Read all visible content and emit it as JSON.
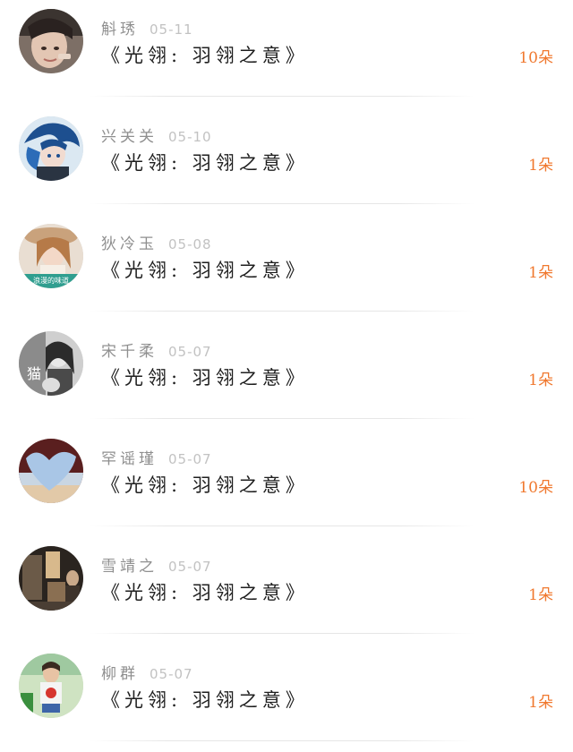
{
  "gift_list": {
    "items": [
      {
        "name": "斛琇",
        "date": "05-11",
        "title": "《光翎: 羽翎之意》",
        "count": "10朵"
      },
      {
        "name": "兴关关",
        "date": "05-10",
        "title": "《光翎: 羽翎之意》",
        "count": "1朵"
      },
      {
        "name": "狄冷玉",
        "date": "05-08",
        "title": "《光翎: 羽翎之意》",
        "count": "1朵",
        "avatar_caption": "浪漫的味道"
      },
      {
        "name": "宋千柔",
        "date": "05-07",
        "title": "《光翎: 羽翎之意》",
        "count": "1朵",
        "avatar_caption": "猫"
      },
      {
        "name": "罕谣瑾",
        "date": "05-07",
        "title": "《光翎: 羽翎之意》",
        "count": "10朵"
      },
      {
        "name": "雪靖之",
        "date": "05-07",
        "title": "《光翎: 羽翎之意》",
        "count": "1朵"
      },
      {
        "name": "柳群",
        "date": "05-07",
        "title": "《光翎: 羽翎之意》",
        "count": "1朵"
      }
    ]
  },
  "colors": {
    "accent": "#f0782e",
    "name": "#8f8f8f",
    "date": "#c2c2c2",
    "title": "#1f1f1f"
  }
}
